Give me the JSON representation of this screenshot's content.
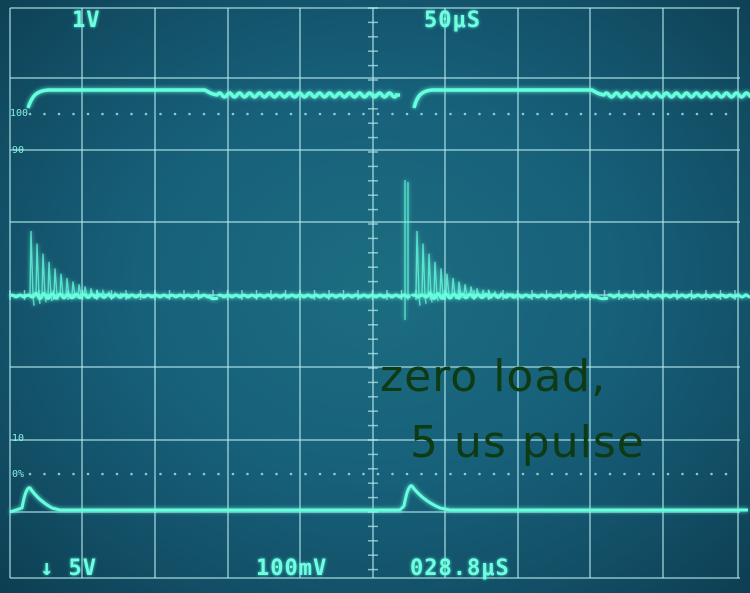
{
  "display": {
    "ch1_scale": "1V",
    "timebase": "50μS",
    "ch2_scale": "↓ 5V",
    "math_scale": "100mV",
    "cursor_time": "028.8μS"
  },
  "graticule_markers": {
    "pct_100": "100",
    "pct_90": "90",
    "pct_10": "10",
    "pct_0": "0%"
  },
  "annotation": {
    "line1": "zero  load,",
    "line2": "5  us pulse"
  },
  "colors": {
    "screen": "#17607a",
    "grid": "#b8ecf0",
    "trace": "#66ffdd",
    "annotation_text": "#0e3a14"
  }
}
